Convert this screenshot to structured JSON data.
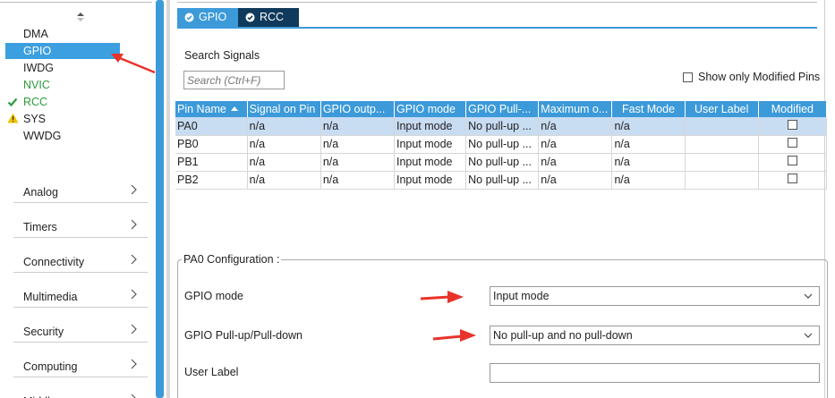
{
  "sidebar": {
    "system_items": [
      {
        "label": "DMA",
        "state": "normal"
      },
      {
        "label": "GPIO",
        "state": "selected"
      },
      {
        "label": "IWDG",
        "state": "normal"
      },
      {
        "label": "NVIC",
        "state": "green"
      },
      {
        "label": "RCC",
        "state": "check"
      },
      {
        "label": "SYS",
        "state": "warning"
      },
      {
        "label": "WWDG",
        "state": "normal"
      }
    ],
    "categories": [
      {
        "label": "Analog"
      },
      {
        "label": "Timers"
      },
      {
        "label": "Connectivity"
      },
      {
        "label": "Multimedia"
      },
      {
        "label": "Security"
      },
      {
        "label": "Computing"
      },
      {
        "label": "Middleware"
      }
    ]
  },
  "tabs": [
    {
      "label": "GPIO",
      "active": true
    },
    {
      "label": "RCC",
      "active": false
    }
  ],
  "search": {
    "title": "Search Signals",
    "placeholder": "Search (Ctrl+F)",
    "show_modified_label": "Show only Modified Pins",
    "show_modified_checked": false
  },
  "pin_table": {
    "columns": [
      "Pin Name",
      "Signal on Pin",
      "GPIO outp...",
      "GPIO mode",
      "GPIO Pull-...",
      "Maximum o...",
      "Fast Mode",
      "User Label",
      "Modified"
    ],
    "rows": [
      {
        "cells": [
          "PA0",
          "n/a",
          "n/a",
          "Input mode",
          "No pull-up ...",
          "n/a",
          "n/a",
          ""
        ],
        "modified": false,
        "selected": true
      },
      {
        "cells": [
          "PB0",
          "n/a",
          "n/a",
          "Input mode",
          "No pull-up ...",
          "n/a",
          "n/a",
          ""
        ],
        "modified": false,
        "selected": false
      },
      {
        "cells": [
          "PB1",
          "n/a",
          "n/a",
          "Input mode",
          "No pull-up ...",
          "n/a",
          "n/a",
          ""
        ],
        "modified": false,
        "selected": false
      },
      {
        "cells": [
          "PB2",
          "n/a",
          "n/a",
          "Input mode",
          "No pull-up ...",
          "n/a",
          "n/a",
          ""
        ],
        "modified": false,
        "selected": false
      }
    ]
  },
  "config": {
    "title": "PA0 Configuration :",
    "gpio_mode_label": "GPIO mode",
    "gpio_mode_value": "Input mode",
    "pull_label": "GPIO Pull-up/Pull-down",
    "pull_value": "No pull-up and no pull-down",
    "user_label_label": "User Label",
    "user_label_value": ""
  },
  "colors": {
    "accent": "#3c9ad9",
    "tab_dark": "#0f3a5c",
    "annotation_arrow": "#e8332a",
    "enabled_green": "#2b9a3c"
  }
}
